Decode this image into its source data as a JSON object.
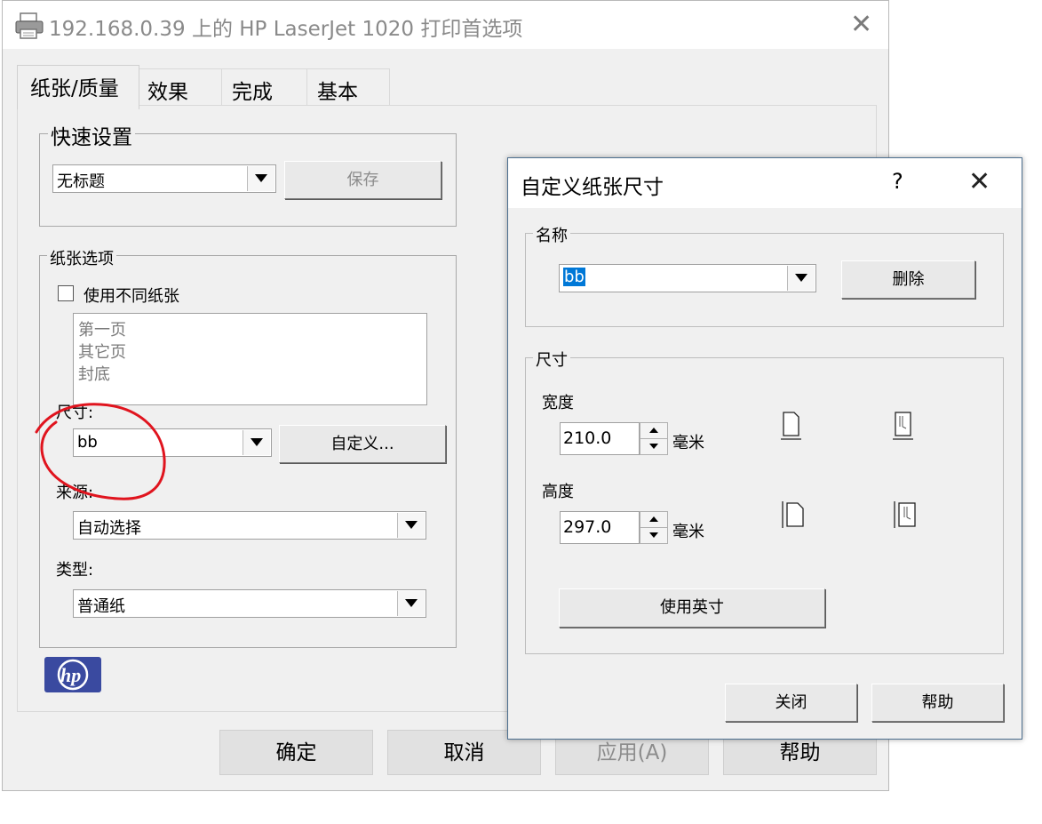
{
  "main_window": {
    "title": "192.168.0.39 上的 HP LaserJet 1020 打印首选项",
    "tabs": [
      "纸张/质量",
      "效果",
      "完成",
      "基本"
    ],
    "quick_settings": {
      "legend": "快速设置",
      "selected": "无标题",
      "save_label": "保存"
    },
    "paper_options": {
      "legend": "纸张选项",
      "use_different_paper_label": "使用不同纸张",
      "list_items": [
        "第一页",
        "其它页",
        "封底"
      ],
      "size_label": "尺寸:",
      "size_value": "bb",
      "custom_button": "自定义...",
      "source_label": "来源:",
      "source_value": "自动选择",
      "type_label": "类型:",
      "type_value": "普通纸"
    },
    "buttons": {
      "ok": "确定",
      "cancel": "取消",
      "apply": "应用(A)",
      "help": "帮助"
    }
  },
  "custom_dialog": {
    "title": "自定义纸张尺寸",
    "help_glyph": "?",
    "name_group": {
      "legend": "名称",
      "value": "bb",
      "delete_button": "删除"
    },
    "size_group": {
      "legend": "尺寸",
      "width_label": "宽度",
      "width_value": "210.0",
      "height_label": "高度",
      "height_value": "297.0",
      "unit": "毫米",
      "use_inches_button": "使用英寸"
    },
    "close_button": "关闭",
    "help_button": "帮助"
  },
  "colors": {
    "annotation_circle": "#e0141e",
    "hp_logo_bg": "#3a4aa0",
    "selection": "#0078d7"
  }
}
